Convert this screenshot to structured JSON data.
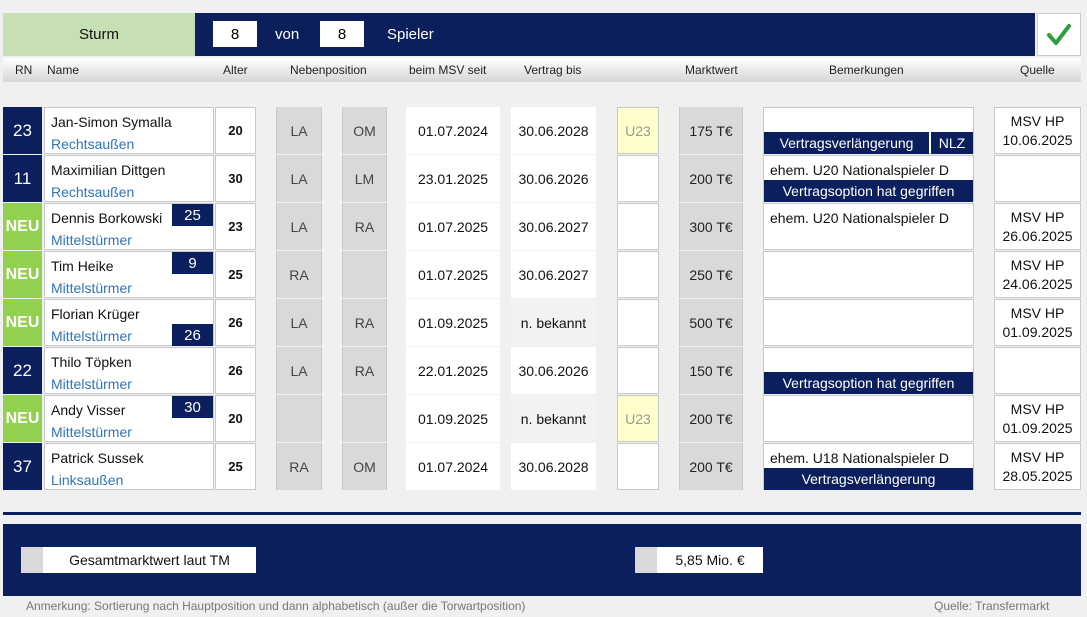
{
  "top": {
    "position_label": "Sturm",
    "count_current": "8",
    "von_label": "von",
    "count_total": "8",
    "spieler_label": "Spieler",
    "check_icon": "checkmark-icon"
  },
  "header": {
    "rn": "RN",
    "name": "Name",
    "alter": "Alter",
    "nebenposition": "Nebenposition",
    "beim_msv_seit": "beim MSV seit",
    "vertrag_bis": "Vertrag bis",
    "marktwert": "Marktwert",
    "bemerkungen": "Bemerkungen",
    "quelle": "Quelle"
  },
  "rows": [
    {
      "rn": "23",
      "rn_style": "navy",
      "name": "Jan-Simon Symalla",
      "position": "Rechtsaußen",
      "badge": "",
      "age": "20",
      "np1": "LA",
      "np2": "OM",
      "since": "01.07.2024",
      "until": "30.06.2028",
      "u23": "U23",
      "value": "175 T€",
      "remark_text": "",
      "remark_bar": "Vertragsverlängerung",
      "remark_tag": "NLZ",
      "src1": "MSV HP",
      "src2": "10.06.2025"
    },
    {
      "rn": "11",
      "rn_style": "navy",
      "name": "Maximilian Dittgen",
      "position": "Rechtsaußen",
      "badge": "",
      "age": "30",
      "np1": "LA",
      "np2": "LM",
      "since": "23.01.2025",
      "until": "30.06.2026",
      "u23": "",
      "value": "200 T€",
      "remark_text": "ehem. U20 Nationalspieler D",
      "remark_bar": "Vertragsoption hat gegriffen",
      "remark_tag": "",
      "src1": "",
      "src2": ""
    },
    {
      "rn": "NEU",
      "rn_style": "green",
      "name": "Dennis Borkowski",
      "position": "Mittelstürmer",
      "badge": "25",
      "age": "23",
      "np1": "LA",
      "np2": "RA",
      "since": "01.07.2025",
      "until": "30.06.2027",
      "u23": "",
      "value": "300 T€",
      "remark_text": "ehem. U20 Nationalspieler D",
      "remark_bar": "",
      "remark_tag": "",
      "src1": "MSV HP",
      "src2": "26.06.2025"
    },
    {
      "rn": "NEU",
      "rn_style": "green",
      "name": "Tim Heike",
      "position": "Mittelstürmer",
      "badge": "9",
      "age": "25",
      "np1": "RA",
      "np2": "",
      "since": "01.07.2025",
      "until": "30.06.2027",
      "u23": "",
      "value": "250 T€",
      "remark_text": "",
      "remark_bar": "",
      "remark_tag": "",
      "src1": "MSV HP",
      "src2": "24.06.2025"
    },
    {
      "rn": "NEU",
      "rn_style": "green",
      "name": "Florian Krüger",
      "position": "Mittelstürmer",
      "badge": "26",
      "age": "26",
      "np1": "LA",
      "np2": "RA",
      "since": "01.09.2025",
      "until": "n. bekannt",
      "u23": "",
      "value": "500 T€",
      "remark_text": "",
      "remark_bar": "",
      "remark_tag": "",
      "src1": "MSV HP",
      "src2": "01.09.2025"
    },
    {
      "rn": "22",
      "rn_style": "navy",
      "name": "Thilo Töpken",
      "position": "Mittelstürmer",
      "badge": "",
      "age": "26",
      "np1": "LA",
      "np2": "RA",
      "since": "22.01.2025",
      "until": "30.06.2026",
      "u23": "",
      "value": "150 T€",
      "remark_text": "",
      "remark_bar": "Vertragsoption hat gegriffen",
      "remark_tag": "",
      "src1": "",
      "src2": ""
    },
    {
      "rn": "NEU",
      "rn_style": "green",
      "name": "Andy Visser",
      "position": "Mittelstürmer",
      "badge": "30",
      "age": "20",
      "np1": "",
      "np2": "",
      "since": "01.09.2025",
      "until": "n. bekannt",
      "u23": "U23",
      "value": "200 T€",
      "remark_text": "",
      "remark_bar": "",
      "remark_tag": "",
      "src1": "MSV HP",
      "src2": "01.09.2025"
    },
    {
      "rn": "37",
      "rn_style": "navy",
      "name": "Patrick Sussek",
      "position": "Linksaußen",
      "badge": "",
      "age": "25",
      "np1": "RA",
      "np2": "OM",
      "since": "01.07.2024",
      "until": "30.06.2028",
      "u23": "",
      "value": "200 T€",
      "remark_text": "ehem. U18 Nationalspieler D",
      "remark_bar": "Vertragsverlängerung",
      "remark_tag": "",
      "src1": "MSV HP",
      "src2": "28.05.2025"
    }
  ],
  "footer": {
    "total_label": "Gesamtmarktwert laut TM",
    "total_value": "5,85 Mio. €",
    "note": "Anmerkung: Sortierung nach Hauptposition und dann alphabetisch (außer die Torwartposition)",
    "source": "Quelle: Transfermarkt"
  },
  "colors": {
    "navy": "#0b1f5c",
    "green_new": "#92d050",
    "position_green": "#c6e0b4",
    "position_blue_text": "#2e75b6",
    "u23_yellow": "#ffffcc",
    "check_green": "#2e9e3e"
  }
}
